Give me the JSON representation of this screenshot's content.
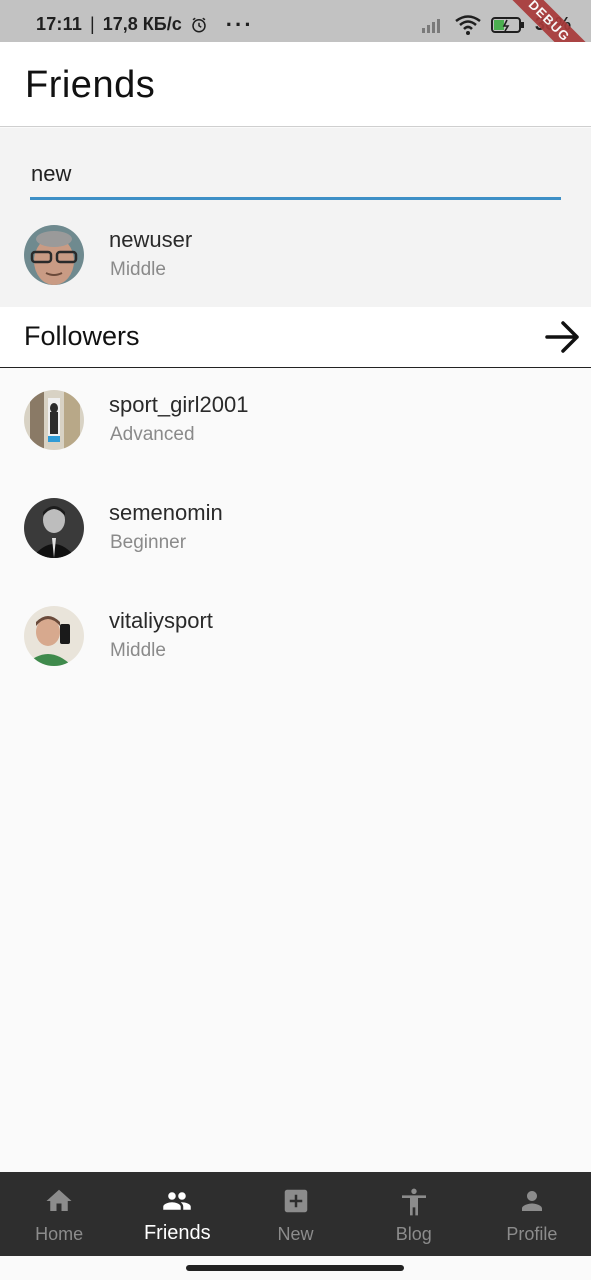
{
  "status_bar": {
    "time": "17:11",
    "separator": "|",
    "speed": "17,8 КБ/с",
    "more": "···",
    "battery": "36%",
    "debug_label": "DEBUG"
  },
  "appbar": {
    "title": "Friends"
  },
  "search": {
    "value": "new",
    "placeholder": ""
  },
  "search_results": [
    {
      "name": "newuser",
      "level": "Middle"
    }
  ],
  "followers": {
    "title": "Followers",
    "items": [
      {
        "name": "sport_girl2001",
        "level": "Advanced"
      },
      {
        "name": "semenomin",
        "level": "Beginner"
      },
      {
        "name": "vitaliysport",
        "level": "Middle"
      }
    ]
  },
  "bottom_nav": {
    "items": [
      {
        "label": "Home",
        "icon": "home-icon"
      },
      {
        "label": "Friends",
        "icon": "people-icon",
        "active": true
      },
      {
        "label": "New",
        "icon": "add-box-icon"
      },
      {
        "label": "Blog",
        "icon": "accessibility-icon"
      },
      {
        "label": "Profile",
        "icon": "person-icon"
      }
    ]
  },
  "colors": {
    "accent": "#3d8fc6",
    "nav_background": "#2e2e2e",
    "status_bar": "#c2c2c2",
    "debug_ribbon": "#a83a3a"
  }
}
